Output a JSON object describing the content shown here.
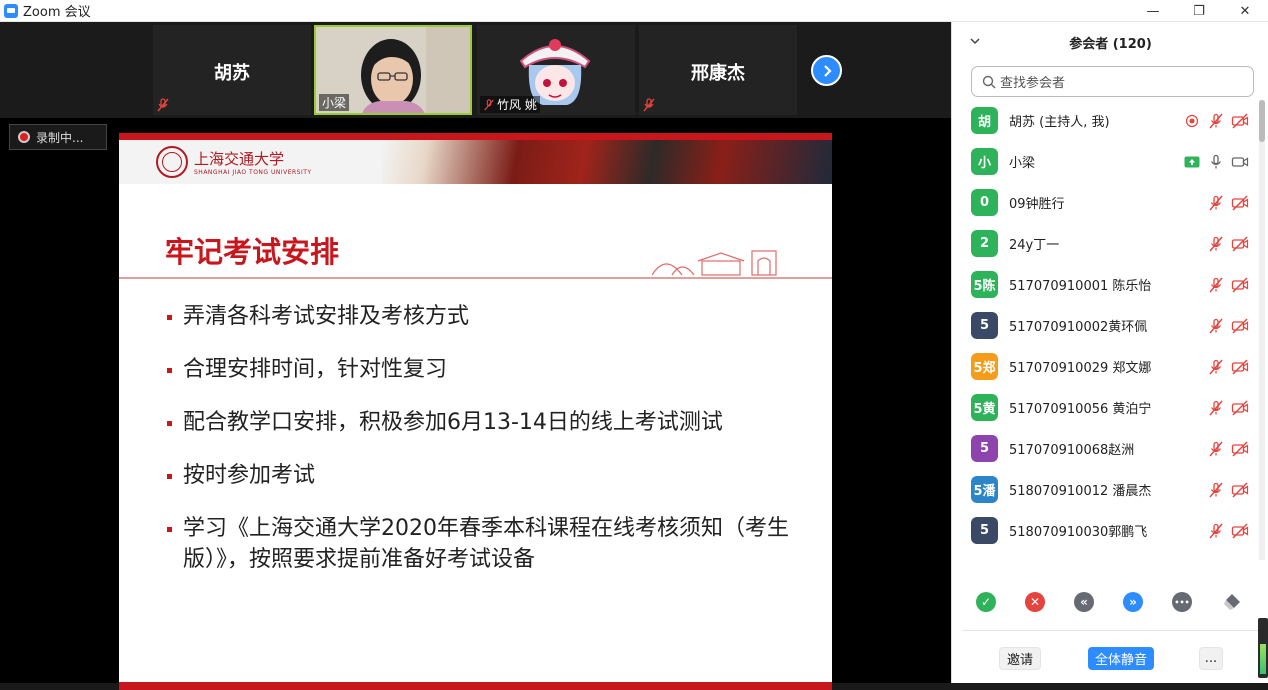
{
  "window": {
    "title": "Zoom 会议",
    "minimize_label": "—",
    "maximize_label": "❐",
    "close_label": "✕"
  },
  "videos": [
    {
      "name": "胡苏",
      "muted": true,
      "show_big_name": true
    },
    {
      "name": "小梁",
      "muted": false,
      "active_speaker": true
    },
    {
      "name": "竹风 姚",
      "muted": true,
      "has_image": true
    },
    {
      "name": "邢康杰",
      "muted": true,
      "show_big_name": true
    }
  ],
  "recording": {
    "label": "录制中..."
  },
  "slide": {
    "logo_text": "上海交通大学",
    "logo_sub": "SHANGHAI JIAO TONG UNIVERSITY",
    "title": "牢记考试安排",
    "bullets": [
      "弄清各科考试安排及考核方式",
      "合理安排时间，针对性复习",
      "配合教学口安排，积极参加6月13-14日的线上考试测试",
      "按时参加考试",
      "学习《上海交通大学2020年春季本科课程在线考核须知（考生版）》，按照要求提前准备好考试设备"
    ]
  },
  "participants_panel": {
    "header": "参会者 (120)",
    "search_placeholder": "查找参会者",
    "participants": [
      {
        "avatar": "胡",
        "color": "#2fb35a",
        "name": "胡苏 (主持人, 我)",
        "recording": true,
        "mic": "muted",
        "video": "off"
      },
      {
        "avatar": "小",
        "color": "#2fb35a",
        "name": "小梁",
        "sharing": true,
        "mic": "on",
        "video": "on"
      },
      {
        "avatar": "0",
        "color": "#2fb35a",
        "name": "09钟胜行",
        "mic": "muted",
        "video": "off"
      },
      {
        "avatar": "2",
        "color": "#2fb35a",
        "name": "24y丁一",
        "mic": "muted",
        "video": "off"
      },
      {
        "avatar": "5陈",
        "color": "#2fb35a",
        "name": "517070910001 陈乐怡",
        "mic": "muted",
        "video": "off"
      },
      {
        "avatar": "5",
        "color": "#3a4a66",
        "name": "517070910002黄环佩",
        "mic": "muted",
        "video": "off"
      },
      {
        "avatar": "5郑",
        "color": "#f59d1a",
        "name": "517070910029 郑文娜",
        "mic": "muted",
        "video": "off"
      },
      {
        "avatar": "5黄",
        "color": "#2fb35a",
        "name": "517070910056 黄泊宁",
        "mic": "muted",
        "video": "off"
      },
      {
        "avatar": "5",
        "color": "#8e44ad",
        "name": "517070910068赵洲",
        "mic": "muted",
        "video": "off"
      },
      {
        "avatar": "5潘",
        "color": "#2b85c8",
        "name": "518070910012 潘晨杰",
        "mic": "muted",
        "video": "off"
      },
      {
        "avatar": "5",
        "color": "#3a4a66",
        "name": "518070910030郭鹏飞",
        "mic": "muted",
        "video": "off"
      }
    ],
    "reactions": [
      {
        "name": "yes",
        "color": "#2fb35a",
        "glyph": "✓"
      },
      {
        "name": "no",
        "color": "#e5433d",
        "glyph": "✕"
      },
      {
        "name": "slower",
        "color": "#666a73",
        "glyph": "«"
      },
      {
        "name": "faster",
        "color": "#2d8cff",
        "glyph": "»"
      },
      {
        "name": "more",
        "color": "#666a73",
        "glyph": "•••"
      },
      {
        "name": "clear",
        "color": "#666a73",
        "glyph": ""
      }
    ],
    "footer": {
      "invite_label": "邀请",
      "mute_all_label": "全体静音",
      "more_label": "..."
    }
  }
}
